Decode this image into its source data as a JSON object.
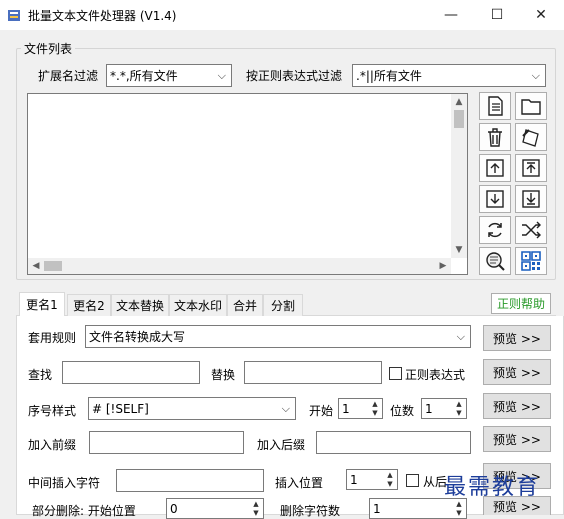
{
  "window": {
    "title": "批量文本文件处理器  (V1.4)",
    "minimize_glyph": "—",
    "maximize_glyph": "☐",
    "close_glyph": "✕"
  },
  "file_list": {
    "legend": "文件列表",
    "ext_filter_label": "扩展名过滤",
    "ext_filter_value": "*.*,所有文件",
    "regex_filter_label": "按正则表达式过滤",
    "regex_filter_value": ".*||所有文件"
  },
  "side_icons": [
    "add-file-icon",
    "add-folder-icon",
    "delete-icon",
    "clear-list-icon",
    "move-up-icon",
    "move-top-icon",
    "move-down-icon",
    "move-bottom-icon",
    "refresh-icon",
    "shuffle-icon",
    "preview-search-icon",
    "qrcode-icon"
  ],
  "tabs": [
    "更名1",
    "更名2",
    "文本替换",
    "文本水印",
    "合并",
    "分割"
  ],
  "active_tab": 0,
  "help_button": "正则帮助",
  "form": {
    "rule_label": "套用规则",
    "rule_value": "文件名转换成大写",
    "find_label": "查找",
    "find_value": "",
    "replace_label": "替换",
    "replace_value": "",
    "regex_label": "正则表达式",
    "seq_style_label": "序号样式",
    "seq_style_value": "# [!SELF]",
    "start_label": "开始",
    "start_value": "1",
    "digits_label": "位数",
    "digits_value": "1",
    "prefix_label": "加入前缀",
    "prefix_value": "",
    "suffix_label": "加入后缀",
    "suffix_value": "",
    "insert_char_label": "中间插入字符",
    "insert_char_value": "",
    "insert_pos_label": "插入位置",
    "insert_pos_value": "1",
    "from_right_label": "从后",
    "partial_delete_label": "部分删除: 开始位置",
    "partial_delete_start": "0",
    "delete_count_label": "删除字符数",
    "delete_count_value": "1",
    "preview_label": "预览 >>"
  },
  "watermark": "最需教育",
  "colors": {
    "help_text": "#2a9a2a",
    "watermark": "#1d3d9a"
  }
}
